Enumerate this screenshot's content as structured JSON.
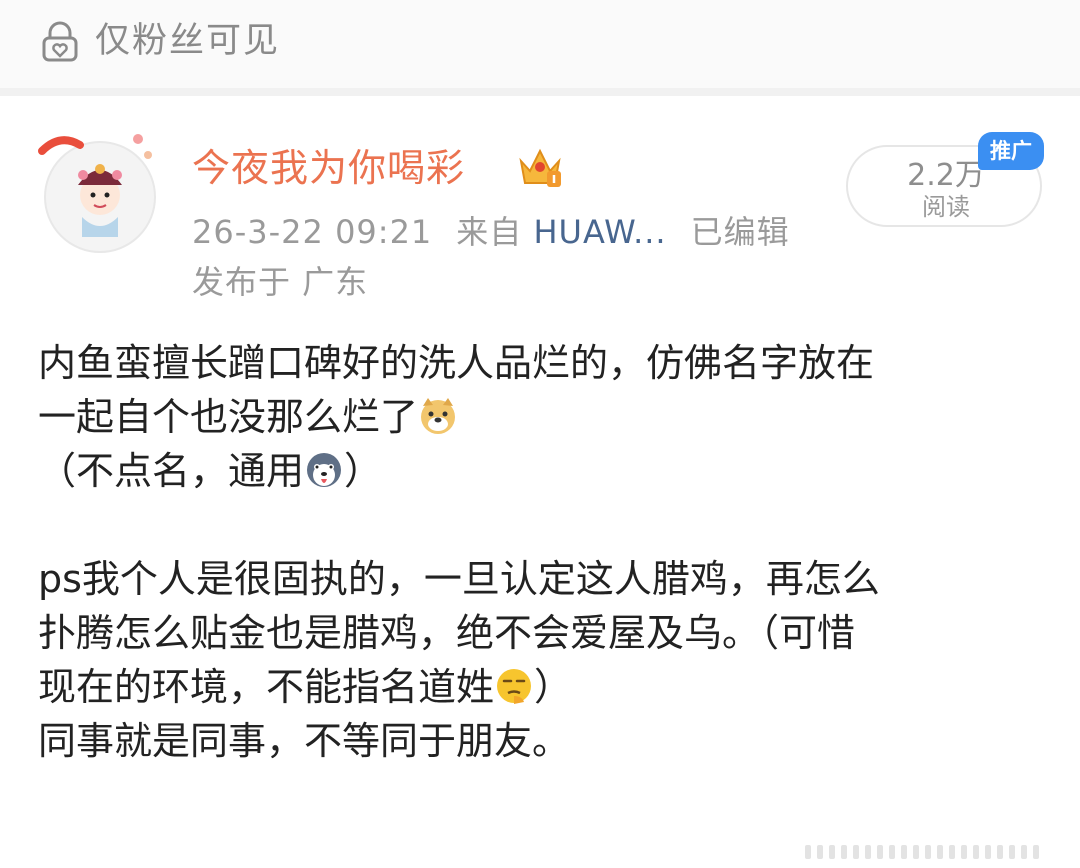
{
  "visibility": {
    "label": "仅粉丝可见",
    "icon": "lock-heart-icon"
  },
  "post": {
    "user": {
      "name": "今夜我为你喝彩",
      "badge_icon": "vip-crown-icon",
      "avatar_icon": "cartoon-opera-avatar"
    },
    "time": "26-3-22 09:21",
    "source_prefix": "来自",
    "source": "HUAW...",
    "edited": "已编辑",
    "location": "发布于 广东",
    "read_count": {
      "value": "2.2万",
      "label": "阅读"
    },
    "promo_badge": "推广",
    "content": {
      "line1": "内鱼蛮擅长蹭口碑好的洗人品烂的，仿佛名字放在",
      "line2": "一起自个也没那么烂了",
      "line2_emoji": "doge-emoji",
      "line3_prefix": "（不点名，通用",
      "line3_emoji": "husky-emoji",
      "line3_suffix": "）",
      "line4": "ps我个人是很固执的，一旦认定这人腊鸡，再怎么",
      "line5": "扑腾怎么贴金也是腊鸡，绝不会爱屋及乌。（可惜",
      "line6_prefix": "现在的环境，不能指名道姓",
      "line6_emoji": "thinking-emoji",
      "line6_suffix": "）",
      "line7": "同事就是同事，不等同于朋友。"
    }
  },
  "colors": {
    "username": "#eb7350",
    "source": "#48668f",
    "promo": "#3b8ff2",
    "meta": "#9a9a9a"
  }
}
